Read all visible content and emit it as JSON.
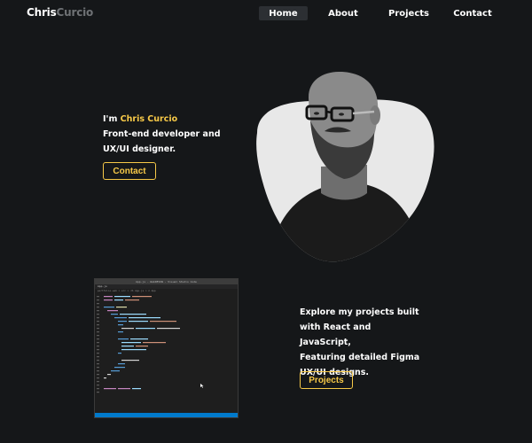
{
  "nav": {
    "logo_first": "Chris",
    "logo_last": "Curcio",
    "items": [
      "Home",
      "About",
      "Projects",
      "Contact"
    ],
    "active": "Home"
  },
  "hero": {
    "intro": "I'm ",
    "name": "Chris Curcio",
    "line2": "Front-end developer and",
    "line3": "UX/UI designer.",
    "button": "Contact"
  },
  "projects": {
    "line1": "Explore my projects built",
    "line2": "with React and JavaScript,",
    "line3": "Featuring detailed Figma",
    "line4": "UX/UI designs.",
    "button": "Projects"
  },
  "editor": {
    "title": "App.js - WebDEVSN - Visual Studio Code",
    "tab": "App.js",
    "breadcrumb": "portfolio-web > src > JS App.js > ⊘ App"
  },
  "colors": {
    "background": "#151719",
    "accent": "#f7c948",
    "nav_active_bg": "#2c2f33",
    "logo_muted": "#6f7275"
  }
}
